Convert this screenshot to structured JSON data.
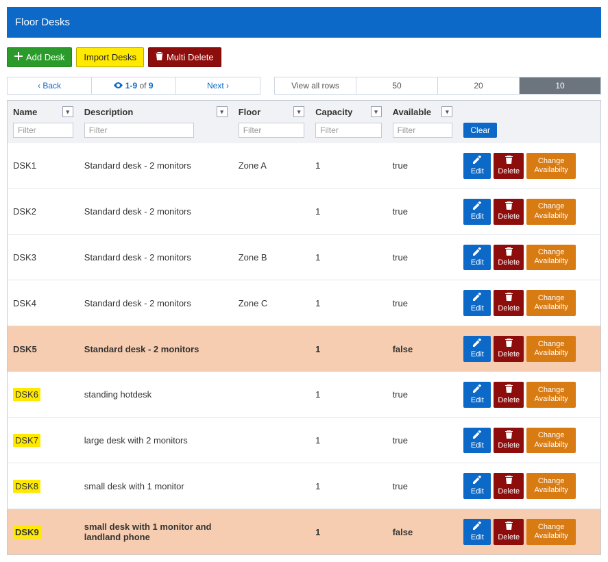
{
  "header": {
    "title": "Floor Desks"
  },
  "toolbar": {
    "add_label": "Add Desk",
    "import_label": "Import Desks",
    "multi_delete_label": "Multi Delete"
  },
  "pager": {
    "back": "Back",
    "info_prefix": "1-9",
    "info_mid": "of",
    "info_suffix": "9",
    "next": "Next",
    "view_all": "View all rows",
    "sizes": [
      "50",
      "20",
      "10"
    ],
    "active_size": "10"
  },
  "columns": {
    "name": "Name",
    "description": "Description",
    "floor": "Floor",
    "capacity": "Capacity",
    "available": "Available"
  },
  "filter_placeholder": "Filter",
  "clear_label": "Clear",
  "action_labels": {
    "edit": "Edit",
    "delete": "Delete",
    "change_availability": "Change Availabilty"
  },
  "rows": [
    {
      "name": "DSK1",
      "description": "Standard desk - 2 monitors",
      "floor": "Zone A",
      "capacity": "1",
      "available": "true",
      "highlight": false
    },
    {
      "name": "DSK2",
      "description": "Standard desk - 2 monitors",
      "floor": "",
      "capacity": "1",
      "available": "true",
      "highlight": false
    },
    {
      "name": "DSK3",
      "description": "Standard desk - 2 monitors",
      "floor": "Zone B",
      "capacity": "1",
      "available": "true",
      "highlight": false
    },
    {
      "name": "DSK4",
      "description": "Standard desk - 2 monitors",
      "floor": "Zone C",
      "capacity": "1",
      "available": "true",
      "highlight": false
    },
    {
      "name": "DSK5",
      "description": "Standard desk - 2 monitors",
      "floor": "",
      "capacity": "1",
      "available": "false",
      "highlight": false
    },
    {
      "name": "DSK6",
      "description": "standing hotdesk",
      "floor": "",
      "capacity": "1",
      "available": "true",
      "highlight": true
    },
    {
      "name": "DSK7",
      "description": "large desk with 2 monitors",
      "floor": "",
      "capacity": "1",
      "available": "true",
      "highlight": true
    },
    {
      "name": "DSK8",
      "description": "small desk with 1 monitor",
      "floor": "",
      "capacity": "1",
      "available": "true",
      "highlight": true
    },
    {
      "name": "DSK9",
      "description": "small desk with 1 monitor and landland phone",
      "floor": "",
      "capacity": "1",
      "available": "false",
      "highlight": true
    }
  ]
}
